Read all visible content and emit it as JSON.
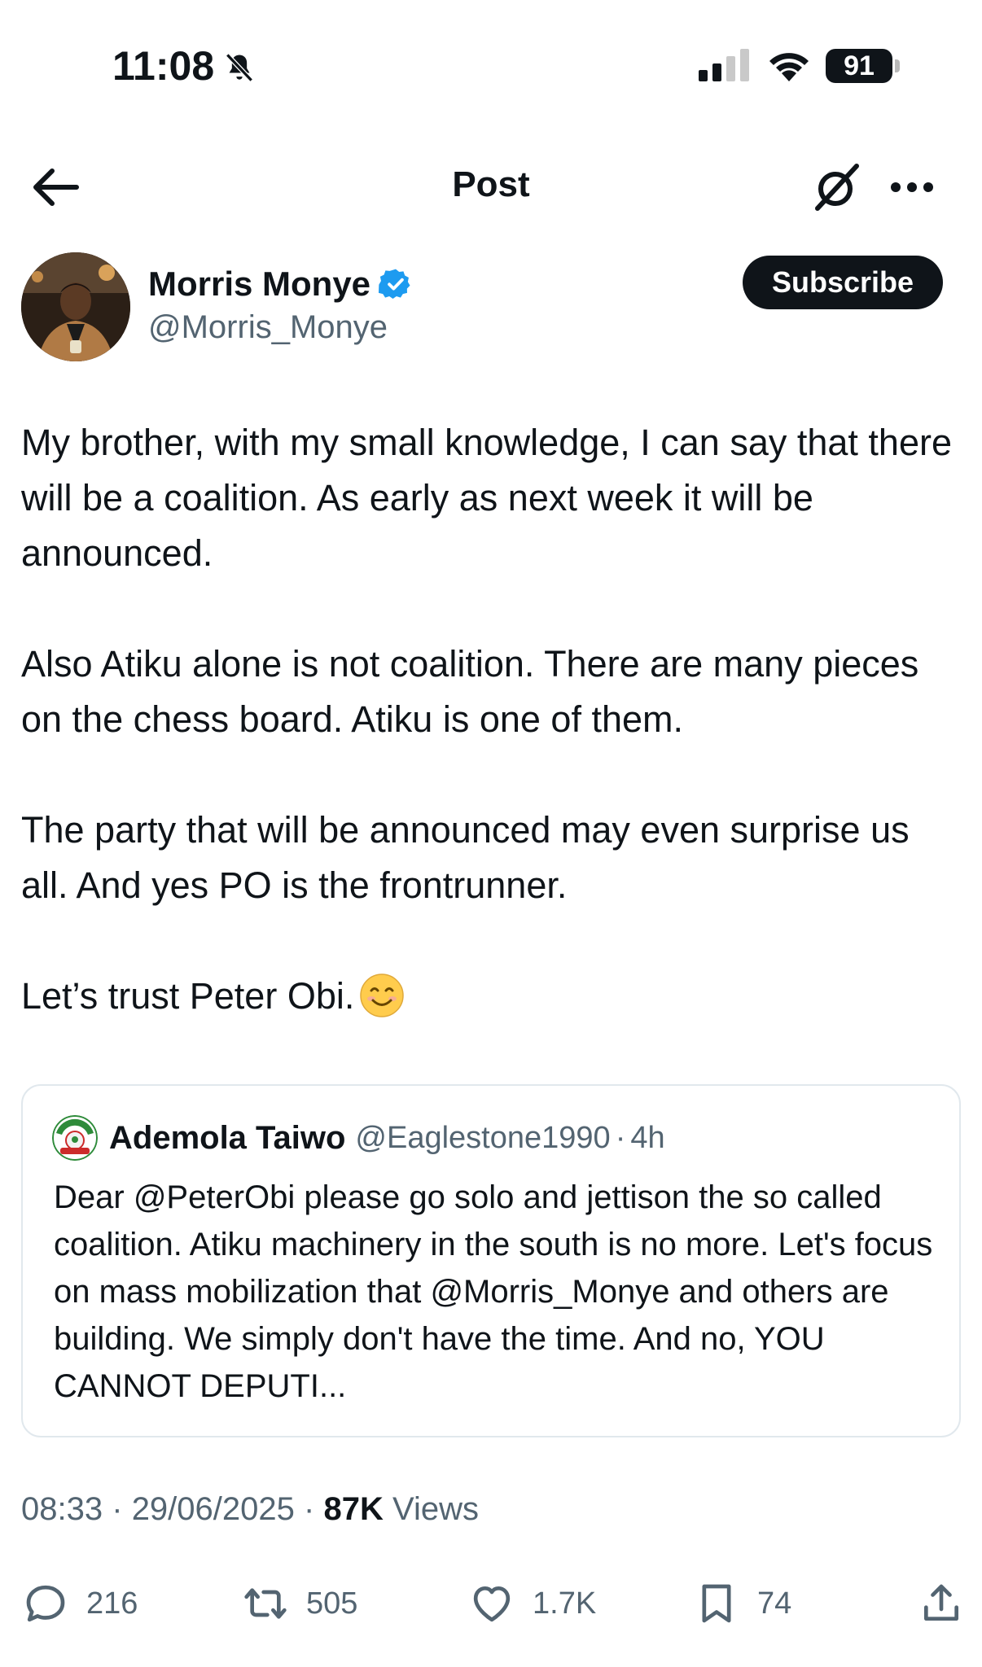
{
  "status_bar": {
    "time": "11:08",
    "battery": "91"
  },
  "header": {
    "title": "Post"
  },
  "author": {
    "name": "Morris Monye",
    "handle": "@Morris_Monye",
    "subscribe_label": "Subscribe"
  },
  "post": {
    "paragraphs": [
      "My brother, with my small knowledge, I can say that there will be a coalition. As early as next week it will be announced.",
      "Also Atiku alone is not coalition. There are many pieces on the chess board. Atiku is one of them.",
      "The party that will  be announced may even surprise us all. And yes PO is the frontrunner.",
      "Let’s trust Peter Obi."
    ]
  },
  "quote": {
    "name": "Ademola Taiwo",
    "handle": "@Eaglestone1990",
    "dot": "·",
    "time": "4h",
    "text": "Dear @PeterObi please go solo and jettison the so called coalition. Atiku machinery in the south is no more. Let's focus on mass mobilization that @Morris_Monye and others are building. We simply don't have the time. And no, YOU CANNOT DEPUTI..."
  },
  "meta": {
    "time": "08:33",
    "sep1": "·",
    "date": "29/06/2025",
    "sep2": "·",
    "views_count": "87K",
    "views_label": "Views"
  },
  "actions": {
    "replies": "216",
    "reposts": "505",
    "likes": "1.7K",
    "bookmarks": "74"
  },
  "icons": {
    "status": [
      "bell-slash-icon",
      "signal-icon",
      "wifi-icon",
      "battery-icon"
    ],
    "header": [
      "back-arrow-icon",
      "grok-icon",
      "more-icon"
    ],
    "author": [
      "verified-badge-icon"
    ],
    "actions": [
      "reply-icon",
      "repost-icon",
      "like-icon",
      "bookmark-icon",
      "share-icon"
    ]
  },
  "colors": {
    "text": "#0f1419",
    "secondary_text": "#536471",
    "verified": "#1d9bf0",
    "border": "#e1e8ed",
    "button_bg": "#0f1419"
  }
}
